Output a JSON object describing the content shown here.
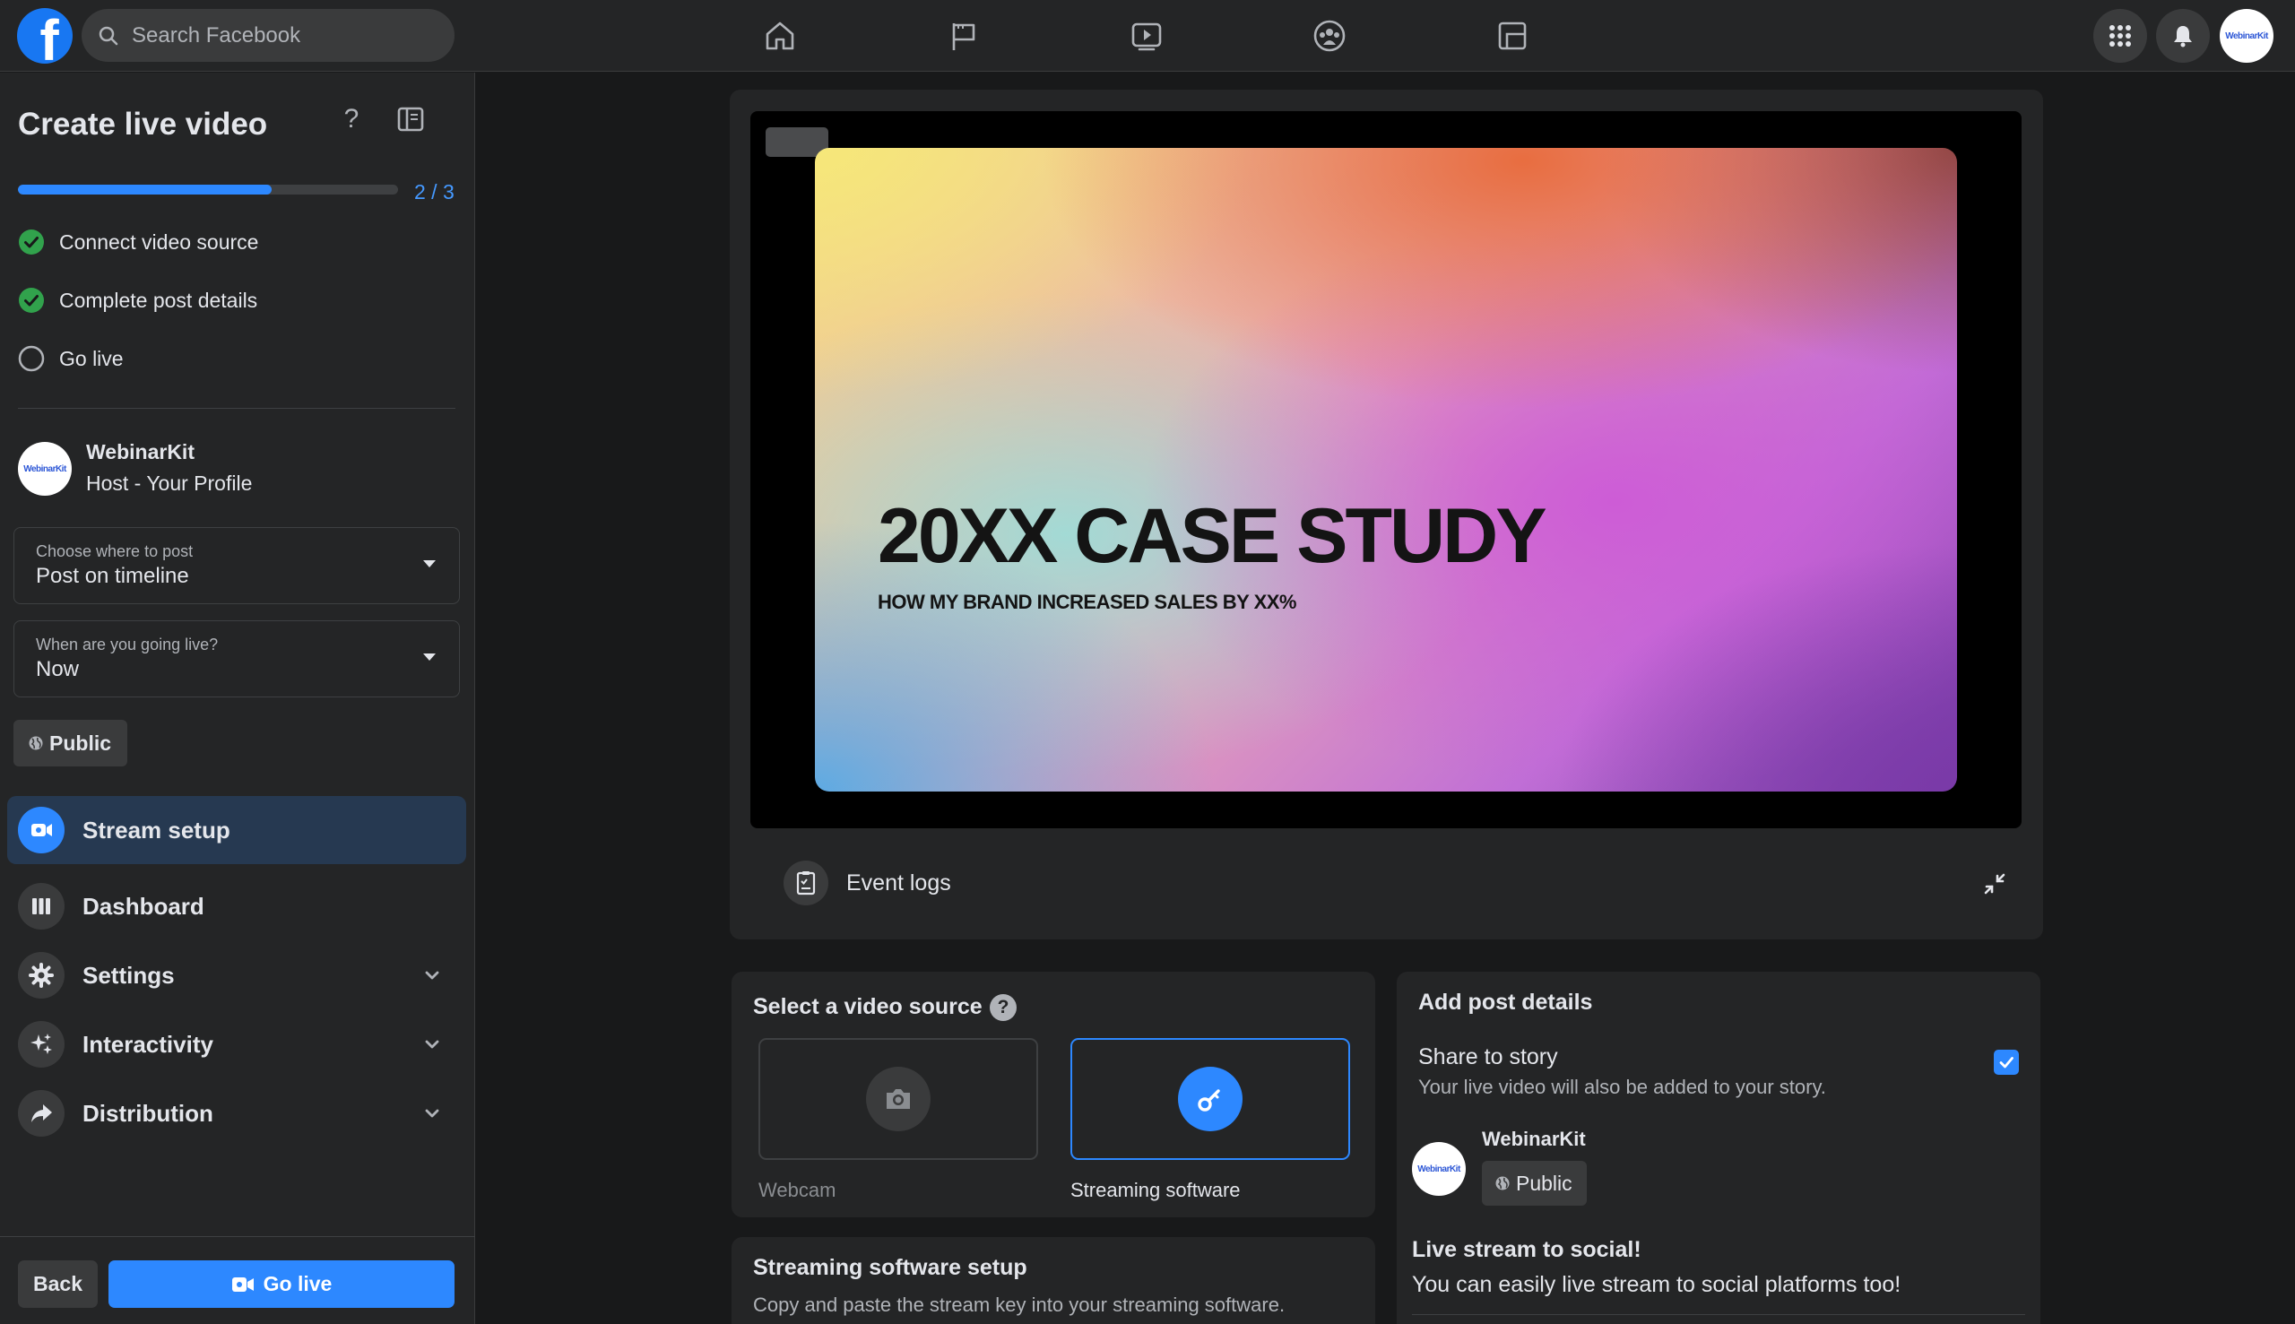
{
  "topbar": {
    "logo": "facebook-logo",
    "search_placeholder": "Search Facebook",
    "nav_icons": [
      "home-icon",
      "flag-icon",
      "watch-icon",
      "groups-icon",
      "gaming-icon"
    ],
    "avatar_text": "WebinarKit"
  },
  "sidebar": {
    "title": "Create live video",
    "progress": {
      "text": "2 / 3",
      "fraction": 0.667
    },
    "steps": [
      {
        "label": "Connect video source",
        "done": true
      },
      {
        "label": "Complete post details",
        "done": true
      },
      {
        "label": "Go live",
        "done": false
      }
    ],
    "host": {
      "name": "WebinarKit",
      "role": "Host - Your Profile",
      "avatar_text": "WebinarKit"
    },
    "post_where": {
      "label": "Choose where to post",
      "value": "Post on timeline"
    },
    "go_live_when": {
      "label": "When are you going live?",
      "value": "Now"
    },
    "privacy": "Public",
    "menu": [
      {
        "label": "Stream setup",
        "active": true
      },
      {
        "label": "Dashboard"
      },
      {
        "label": "Settings"
      },
      {
        "label": "Interactivity"
      },
      {
        "label": "Distribution"
      }
    ],
    "back_label": "Back",
    "go_live_label": "Go live"
  },
  "preview": {
    "slide_title": "20XX CASE STUDY",
    "slide_subtitle": "HOW MY BRAND INCREASED SALES BY XX%",
    "event_logs_label": "Event logs"
  },
  "video_source": {
    "title": "Select a video source",
    "help": "?",
    "options": [
      {
        "label": "Webcam",
        "selected": false
      },
      {
        "label": "Streaming software",
        "selected": true
      }
    ]
  },
  "streaming_setup": {
    "title": "Streaming software setup",
    "description": "Copy and paste the stream key into your streaming software."
  },
  "post_details": {
    "title": "Add post details",
    "share_title": "Share to story",
    "share_desc": "Your live video will also be added to your story.",
    "share_checked": true,
    "name": "WebinarKit",
    "avatar_text": "WebinarKit",
    "privacy": "Public",
    "social_title": "Live stream to social!",
    "social_desc": "You can easily live stream to social platforms too!"
  },
  "colors": {
    "accent": "#2d88ff",
    "success": "#31a24c",
    "surface": "#242526",
    "background": "#18191a"
  }
}
